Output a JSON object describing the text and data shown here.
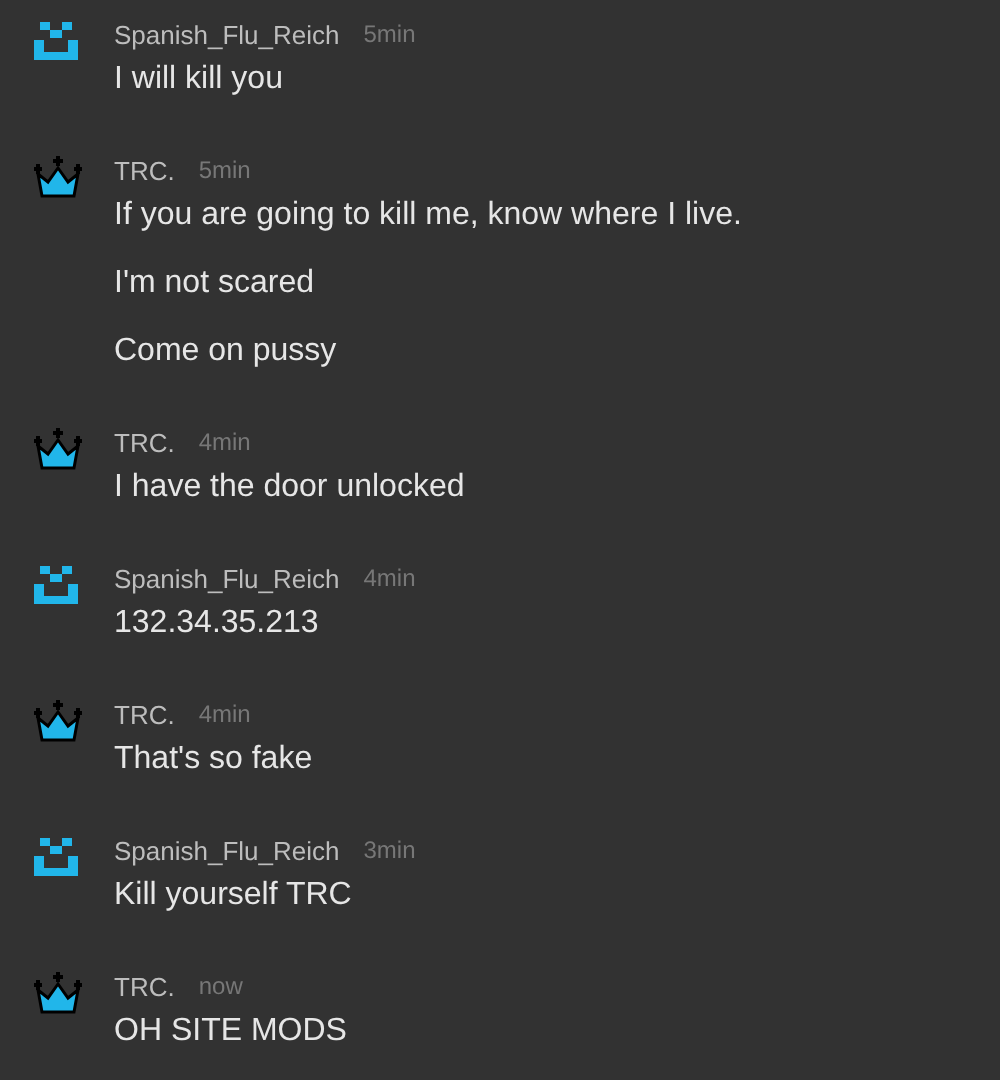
{
  "messages": [
    {
      "kind": "smiley",
      "user": "Spanish_Flu_Reich",
      "time": "5min",
      "lines": [
        "I will kill you"
      ]
    },
    {
      "kind": "crown",
      "user": "TRC.",
      "time": "5min",
      "lines": [
        "If you are going to kill me, know where I live.",
        "I'm not scared",
        "Come on pussy"
      ]
    },
    {
      "kind": "crown",
      "user": "TRC.",
      "time": "4min",
      "lines": [
        "I have the door unlocked"
      ]
    },
    {
      "kind": "smiley",
      "user": "Spanish_Flu_Reich",
      "time": "4min",
      "lines": [
        "132.34.35.213"
      ]
    },
    {
      "kind": "crown",
      "user": "TRC.",
      "time": "4min",
      "lines": [
        "That's so fake"
      ]
    },
    {
      "kind": "smiley",
      "user": "Spanish_Flu_Reich",
      "time": "3min",
      "lines": [
        "Kill yourself TRC"
      ]
    },
    {
      "kind": "crown",
      "user": "TRC.",
      "time": "now",
      "lines": [
        "OH SITE MODS"
      ]
    }
  ]
}
